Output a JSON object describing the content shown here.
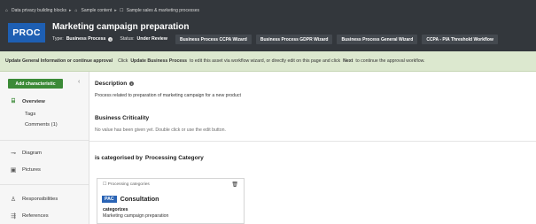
{
  "breadcrumb": [
    {
      "icon": "home-icon",
      "label": "Data privacy building blocks"
    },
    {
      "icon": "home-icon",
      "label": "Sample content"
    },
    {
      "icon": "folder-icon",
      "label": "Sample sales & marketing processes"
    }
  ],
  "asset": {
    "badge": "PROC",
    "title": "Marketing campaign preparation",
    "type_label": "Type:",
    "type_value": "Business Process",
    "status_label": "Status:",
    "status_value": "Under Review"
  },
  "wizards": [
    "Business Process CCPA Wizard",
    "Business Process GDPR Wizard",
    "Business Process General Wizard",
    "CCPA - PIA Threshold Workflow"
  ],
  "banner": {
    "bold": "Update General Information or continue approval",
    "text1": "Click",
    "bold2": "Update Business Process",
    "text2": "to edit this asset via workflow wizard, or directly edit on this page and click",
    "bold3": "Next",
    "text3": "to continue the approval workflow."
  },
  "sidebar": {
    "add_button": "Add characteristic",
    "collapse_icon": "chevron-left-icon",
    "overview": "Overview",
    "tags": "Tags",
    "comments": "Comments (1)",
    "diagram": "Diagram",
    "pictures": "Pictures",
    "responsibilities": "Responsibilities",
    "references": "References"
  },
  "main": {
    "description_title": "Description",
    "description_text": "Process related to preparation of marketing campaign for a new product",
    "criticality_title": "Business Criticality",
    "criticality_text": "No value has been given yet. Double click or use the edit button.",
    "categorised_prefix": "is categorised by",
    "categorised_value": "Processing Category",
    "card": {
      "header": "Processing categories",
      "badge": "PAC",
      "title": "Consultation",
      "relation": "categorizes",
      "target": "Marketing campaign preparation"
    }
  },
  "colors": {
    "header_bg": "#33373c",
    "proc_badge": "#1e5fb3",
    "banner_bg": "#dce8cf",
    "add_button": "#3b8a37",
    "pac_badge": "#2a64b5"
  }
}
